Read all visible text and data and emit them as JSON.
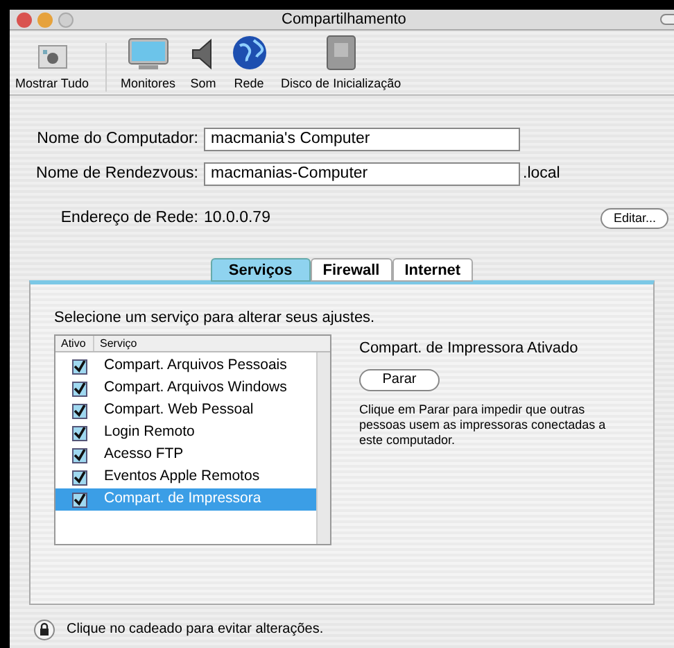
{
  "window": {
    "title": "Compartilhamento"
  },
  "toolbar": [
    {
      "label": "Mostrar Tudo",
      "kind": "showall"
    },
    {
      "label": "Monitores",
      "kind": "monitor"
    },
    {
      "label": "Som",
      "kind": "speaker"
    },
    {
      "label": "Rede",
      "kind": "globe"
    },
    {
      "label": "Disco de Inicialização",
      "kind": "disk"
    }
  ],
  "computer_name": {
    "label": "Nome do Computador:",
    "value": "macmania's Computer"
  },
  "rendezvous_name": {
    "label": "Nome de Rendezvous:",
    "value": "macmanias-Computer",
    "suffix": ".local"
  },
  "network_address": {
    "label": "Endereço de Rede:",
    "value": "10.0.0.79",
    "button": "Editar..."
  },
  "tabs": [
    {
      "label": "Serviços",
      "selected": true
    },
    {
      "label": "Firewall",
      "selected": false
    },
    {
      "label": "Internet",
      "selected": false
    }
  ],
  "services_panel": {
    "instruction": "Selecione um serviço para alterar seus ajustes.",
    "columns": [
      "Ativo",
      "Serviço"
    ],
    "rows": [
      {
        "name": "Compart. Arquivos Pessoais",
        "checked": true,
        "selected": false
      },
      {
        "name": "Compart. Arquivos Windows",
        "checked": true,
        "selected": false
      },
      {
        "name": "Compart. Web Pessoal",
        "checked": true,
        "selected": false
      },
      {
        "name": "Login Remoto",
        "checked": true,
        "selected": false
      },
      {
        "name": "Acesso FTP",
        "checked": true,
        "selected": false
      },
      {
        "name": "Eventos Apple Remotos",
        "checked": true,
        "selected": false
      },
      {
        "name": "Compart. de Impressora",
        "checked": true,
        "selected": true
      }
    ],
    "status": "Compart. de Impressora Ativado",
    "button": "Parar",
    "description": "Clique em Parar para impedir que outras pessoas usem as impressoras conectadas a este computador."
  },
  "lock_message": "Clique no cadeado para evitar alterações."
}
